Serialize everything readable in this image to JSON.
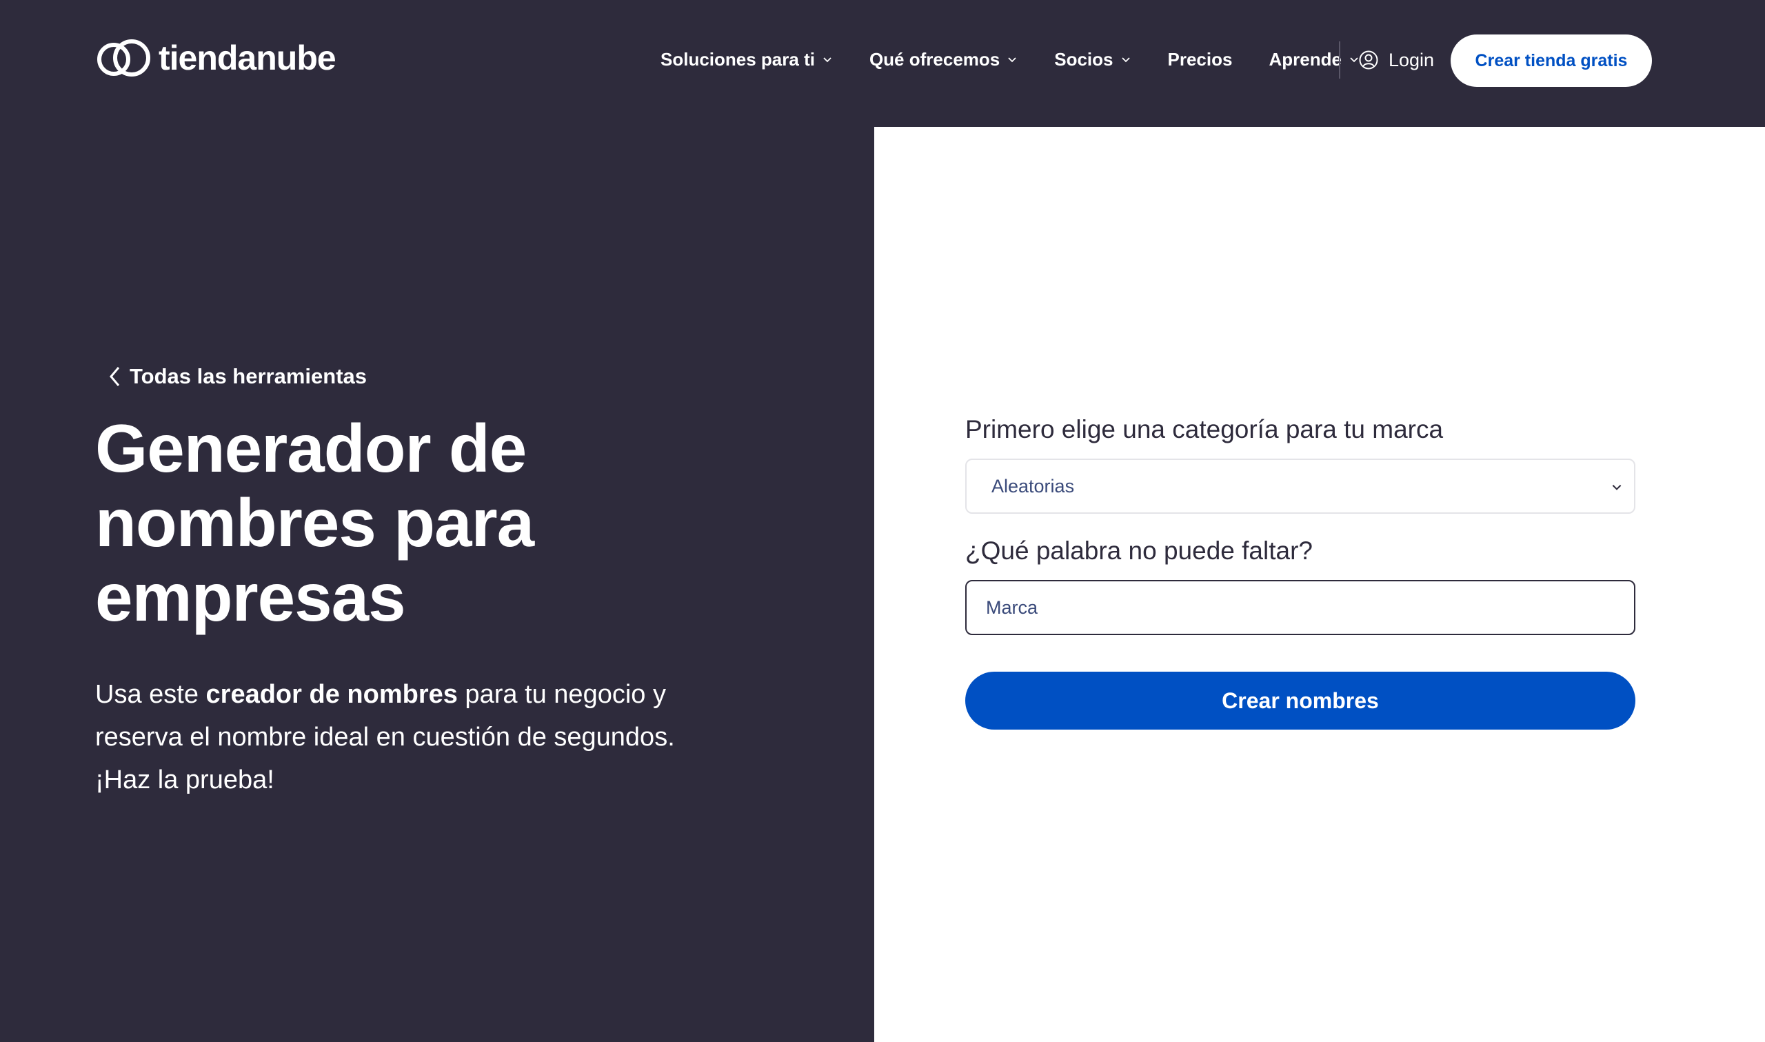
{
  "brand": {
    "name": "tiendanube"
  },
  "nav": {
    "items": [
      {
        "label": "Soluciones para ti",
        "has_dropdown": true
      },
      {
        "label": "Qué ofrecemos",
        "has_dropdown": true
      },
      {
        "label": "Socios",
        "has_dropdown": true
      },
      {
        "label": "Precios",
        "has_dropdown": false
      },
      {
        "label": "Aprende",
        "has_dropdown": true
      }
    ],
    "login_label": "Login",
    "cta_label": "Crear tienda gratis"
  },
  "hero": {
    "back_label": "Todas las herramientas",
    "title": "Generador de nombres para empresas",
    "desc_before": "Usa este ",
    "desc_bold": "creador de nombres",
    "desc_after": " para tu negocio y reserva el nombre ideal en cuestión de segundos. ¡Haz la prueba!"
  },
  "form": {
    "category_label": "Primero elige una categoría para tu marca",
    "category_value": "Aleatorias",
    "word_label": "¿Qué palabra no puede faltar?",
    "word_value": "Marca",
    "submit_label": "Crear nombres"
  },
  "colors": {
    "background": "#2e2b3c",
    "panel": "#ffffff",
    "accent": "#0050c3",
    "text_light": "#ffffff",
    "text_dark": "#2e2b3c"
  },
  "icons": {
    "logo": "cloud-logo-icon",
    "dropdown": "chevron-down-icon",
    "login": "user-circle-icon",
    "back": "chevron-left-icon"
  }
}
